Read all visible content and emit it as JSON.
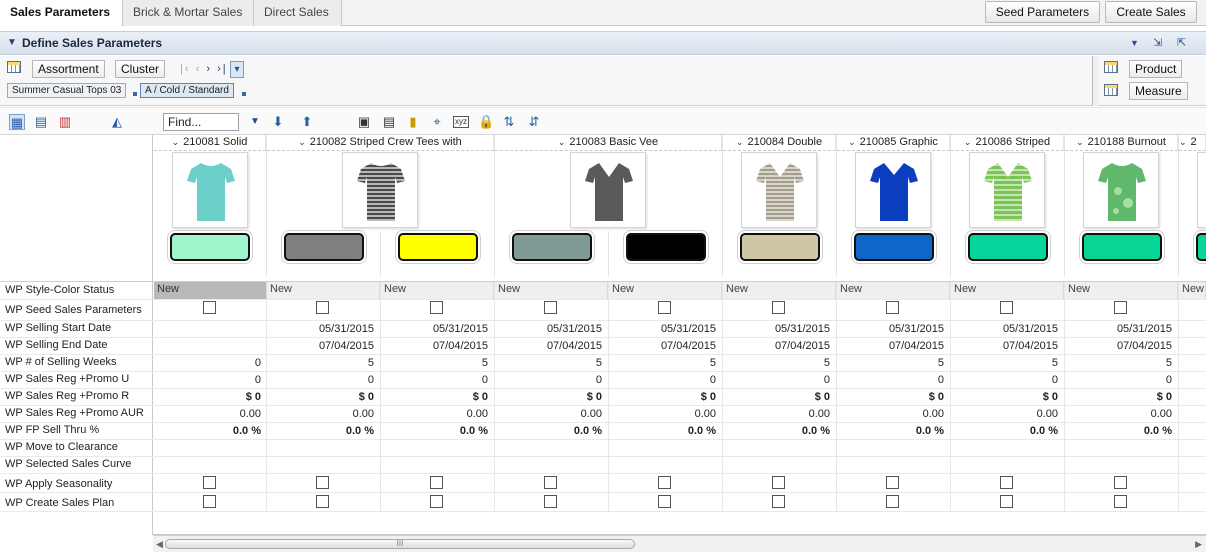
{
  "tabs": [
    {
      "label": "Sales Parameters",
      "active": true
    },
    {
      "label": "Brick & Mortar Sales",
      "active": false
    },
    {
      "label": "Direct Sales",
      "active": false
    }
  ],
  "top_actions": {
    "seed": "Seed Parameters",
    "create": "Create Sales"
  },
  "section": {
    "title": "Define Sales Parameters"
  },
  "filter": {
    "assortment_btn": "Assortment",
    "cluster_btn": "Cluster",
    "assortment_value": "Summer Casual Tops 03",
    "cluster_value": "A / Cold / Standard",
    "product_btn": "Product",
    "measure_btn": "Measure"
  },
  "toolbar": {
    "find_placeholder": "Find..."
  },
  "columns": [
    {
      "header": "210081 Solid",
      "color": "#9ff5cc",
      "shirt_color": "#6ccfc9"
    },
    {
      "header": "210082 Striped Crew Tees with",
      "colors": [
        "#7f7f7f",
        "#ffff00"
      ],
      "shirt_color": "#6f6f6f"
    },
    {
      "header": "210083 Basic Vee",
      "colors": [
        "#809a97",
        "#000000"
      ],
      "shirt_color": "#5a5a5a"
    },
    {
      "header": "210084 Double",
      "color": "#cfc7a3",
      "shirt_color": "#b9b2a5"
    },
    {
      "header": "210085 Graphic",
      "color": "#0f66c8",
      "shirt_color": "#0b3fc0"
    },
    {
      "header": "210086 Striped",
      "color": "#05d59a",
      "shirt_color": "#7cc35a"
    },
    {
      "header": "210188 Burnout",
      "color": "#08d496",
      "shirt_color": "#5fb86b"
    },
    {
      "header": "2"
    }
  ],
  "row_labels": [
    "WP Style-Color Status",
    "WP Seed Sales Parameters",
    "WP Selling Start Date",
    "WP Selling End Date",
    "WP # of Selling Weeks",
    "WP Sales Reg +Promo U",
    "WP Sales Reg +Promo R",
    "WP Sales Reg +Promo AUR",
    "WP FP Sell Thru %",
    "WP Move to Clearance",
    "WP Selected Sales Curve",
    "WP Apply Seasonality",
    "WP Create Sales Plan"
  ],
  "status_value": "New",
  "start_date": "05/31/2015",
  "end_date": "07/04/2015",
  "first_col": {
    "weeks": "0",
    "units": "0",
    "retail": "$ 0",
    "aur": "0.00",
    "sell_thru": "0.0 %"
  },
  "other_cols": {
    "weeks": "5",
    "units": "0",
    "retail": "$ 0",
    "aur": "0.00",
    "sell_thru": "0.0 %"
  },
  "scroll_grip": "III"
}
